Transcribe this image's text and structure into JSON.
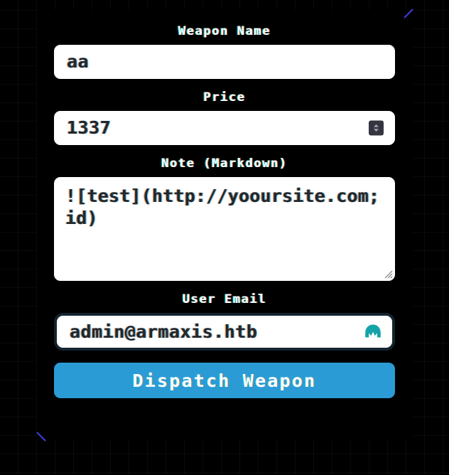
{
  "theme": {
    "page_background": "#000000",
    "card_background": "#000000",
    "input_background": "#ffffff",
    "input_text": "#22272e",
    "label_text": "#ffffff",
    "accent_blue": "#2b9bd6",
    "corner_accent": "#3b3bd8",
    "focus_ring": "#14242f",
    "spinner_background": "#343541",
    "autofill_icon_color": "#14a3a8",
    "grid_line": "rgba(120,120,130,0.085)"
  },
  "form": {
    "weapon_name": {
      "label": "Weapon Name",
      "value": "aa",
      "placeholder": ""
    },
    "price": {
      "label": "Price",
      "value": "1337",
      "placeholder": "",
      "spinner_icon": "spinner-up-down-icon"
    },
    "note": {
      "label": "Note (Markdown)",
      "value": "![test](http://yooursite.com;id)",
      "placeholder": "",
      "resize_handle_icon": "resize-grip-icon"
    },
    "user_email": {
      "label": "User Email",
      "value": "admin@armaxis.htb",
      "placeholder": "",
      "focused": true,
      "autofill_icon": "password-manager-autofill-icon"
    },
    "submit": {
      "label": "Dispatch Weapon"
    }
  },
  "decorations": {
    "top_right_accent_icon": "diagonal-accent-line-icon",
    "bottom_left_accent_icon": "diagonal-accent-line-icon"
  }
}
